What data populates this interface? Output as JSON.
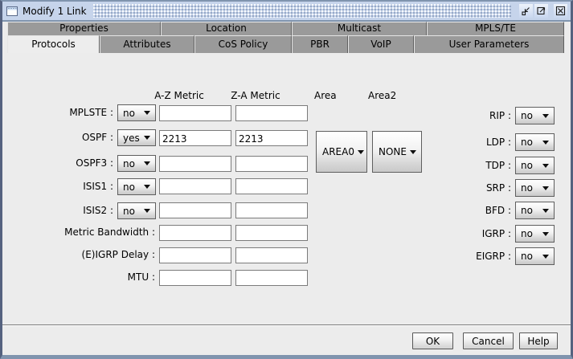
{
  "window": {
    "title": "Modify 1 Link"
  },
  "icons": {
    "window_icon": "application-window",
    "minimize_icon": "minimize-window",
    "maximize_icon": "maximize-window",
    "close_icon": "close-window",
    "dropdown_arrow": "chevron-down"
  },
  "colors": {
    "titlebar": "#c6d4eb",
    "titlebar_border": "#8094ae",
    "window_frame": "#55627f",
    "tab_inactive": "#9a9a9a",
    "panel": "#ececec",
    "field_bg": "#ffffff",
    "text": "#000000"
  },
  "tabs": {
    "row1": [
      {
        "label": "Properties"
      },
      {
        "label": "Location"
      },
      {
        "label": "Multicast"
      },
      {
        "label": "MPLS/TE"
      }
    ],
    "row2": [
      {
        "label": "Protocols",
        "selected": true
      },
      {
        "label": "Attributes"
      },
      {
        "label": "CoS Policy"
      },
      {
        "label": "PBR"
      },
      {
        "label": "VoIP"
      },
      {
        "label": "User Parameters"
      }
    ]
  },
  "form": {
    "headers": {
      "az": "A-Z Metric",
      "za": "Z-A Metric",
      "area": "Area",
      "area2": "Area2"
    },
    "protocol_rows": [
      {
        "label": "MPLSTE :",
        "enabled": "no",
        "az_metric": "",
        "za_metric": ""
      },
      {
        "label": "OSPF :",
        "enabled": "yes",
        "az_metric": "2213",
        "za_metric": "2213"
      },
      {
        "label": "OSPF3 :",
        "enabled": "no",
        "az_metric": "",
        "za_metric": ""
      },
      {
        "label": "ISIS1 :",
        "enabled": "no",
        "az_metric": "",
        "za_metric": ""
      },
      {
        "label": "ISIS2 :",
        "enabled": "no",
        "az_metric": "",
        "za_metric": ""
      }
    ],
    "metric_rows": [
      {
        "label": "Metric Bandwidth :",
        "az_metric": "",
        "za_metric": ""
      },
      {
        "label": "(E)IGRP Delay :",
        "az_metric": "",
        "za_metric": ""
      },
      {
        "label": "MTU :",
        "az_metric": "",
        "za_metric": ""
      }
    ],
    "area": {
      "value": "AREA0"
    },
    "area2": {
      "value": "NONE"
    },
    "right_rows": [
      {
        "label": "RIP :",
        "value": "no"
      },
      {
        "label": "LDP :",
        "value": "no"
      },
      {
        "label": "TDP :",
        "value": "no"
      },
      {
        "label": "SRP :",
        "value": "no"
      },
      {
        "label": "BFD :",
        "value": "no"
      },
      {
        "label": "IGRP :",
        "value": "no"
      },
      {
        "label": "EIGRP :",
        "value": "no"
      }
    ]
  },
  "buttons": {
    "ok": "OK",
    "cancel": "Cancel",
    "help": "Help"
  }
}
